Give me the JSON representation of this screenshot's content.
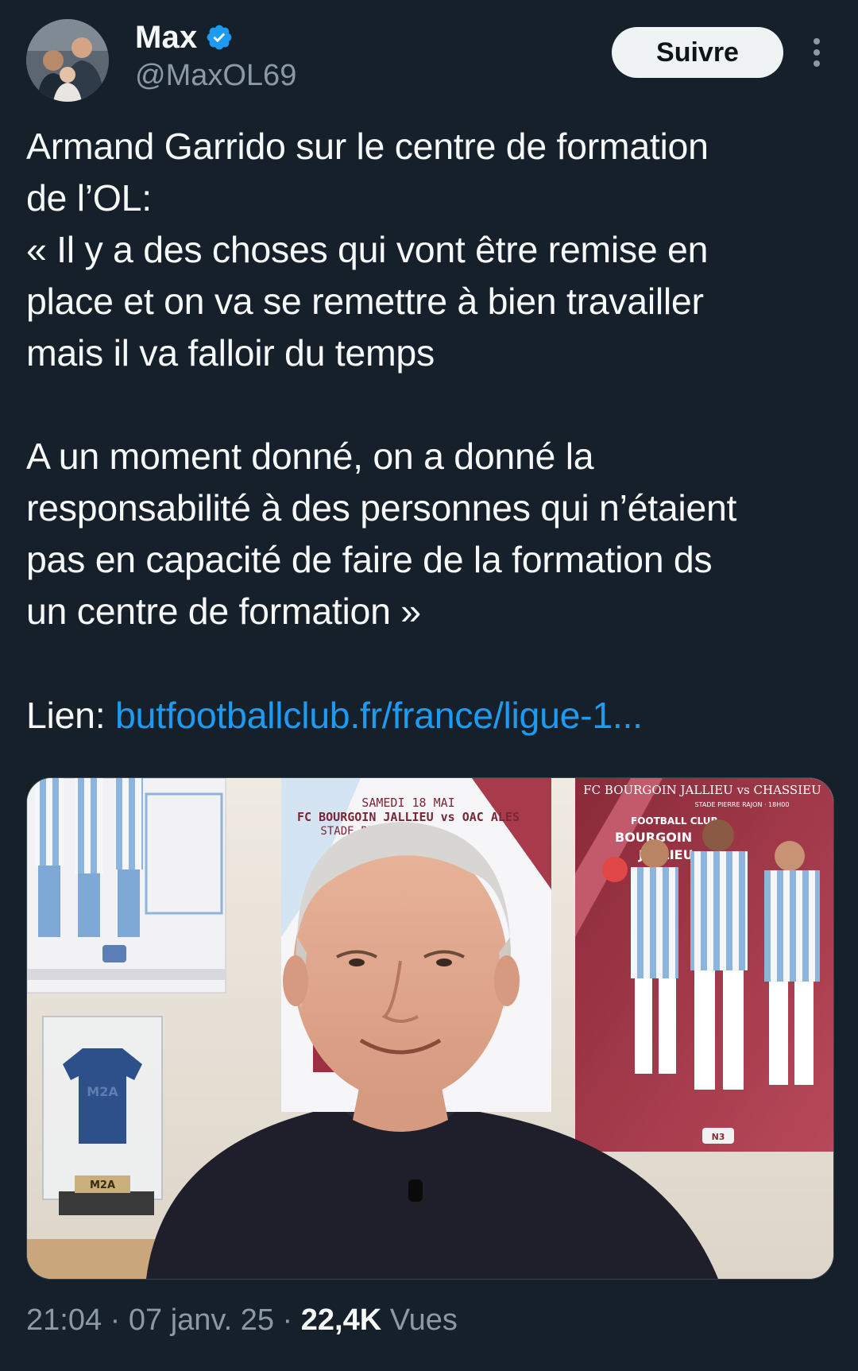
{
  "author": {
    "display_name": "Max",
    "handle": "@MaxOL69",
    "verified_icon": "verified-badge-icon",
    "avatar_icon": "user-avatar-photo"
  },
  "follow_button": {
    "label": "Suivre"
  },
  "more_icon": "more-vertical-icon",
  "tweet": {
    "text": "Armand Garrido sur le centre de formation\nde l’OL:\n« Il y a des choses qui vont être remise en\nplace et on va se remettre à bien travailler\nmais il va falloir du temps\n\nA un moment donné, on a donné la\nresponsabilité à des personnes qui n’étaient\npas en capacité de faire de la formation ds\nun centre de formation »",
    "link_prefix": "Lien: ",
    "link_text": "butfootballclub.fr/france/ligue-1..."
  },
  "media": {
    "poster_left_caption": "SAMEDI 18 MAI",
    "poster_left_title": "FC BOURGOIN JALLIEU vs OAC ALES",
    "poster_left_sub": "STADE PIERRE",
    "poster_right_title": "FC BOURGOIN JALLIEU vs CHASSIEU",
    "poster_right_sub": "STADE PIERRE RAJON · 18H00",
    "poster_right_club_1": "FOOTBALL CLUB",
    "poster_right_club_2": "BOURGOIN",
    "poster_right_club_3": "JALLIEU",
    "jersey_text": "M2A",
    "trophy_plate": "M2A",
    "badge_n3": "N3"
  },
  "meta": {
    "time": "21:04",
    "separator": " · ",
    "date": "07 janv. 25",
    "views_count": "22,4K",
    "views_label": " Vues"
  },
  "colors": {
    "background": "#15202b",
    "text_primary": "#f7f9f9",
    "text_secondary": "#8b98a5",
    "link": "#1d9bf0",
    "verified": "#1d9bf0",
    "follow_bg": "#eff3f4"
  }
}
